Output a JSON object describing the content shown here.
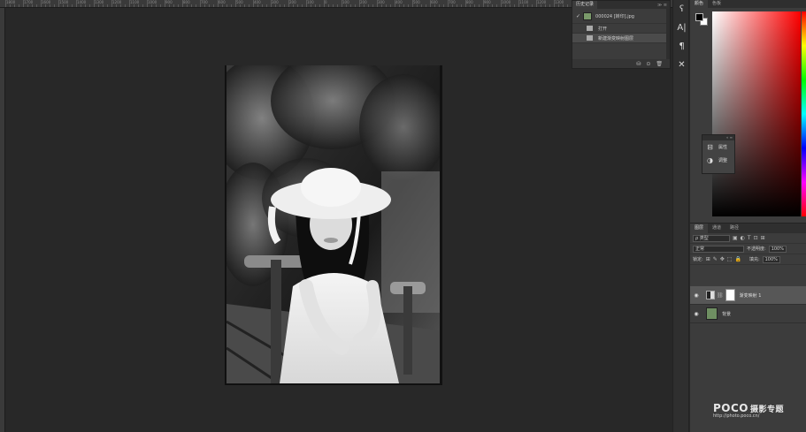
{
  "ruler": {
    "labels": [
      "1800",
      "1700",
      "1600",
      "1500",
      "1400",
      "1300",
      "1200",
      "1100",
      "1000",
      "900",
      "800",
      "700",
      "600",
      "500",
      "400",
      "300",
      "200",
      "100",
      "0",
      "100",
      "200",
      "300",
      "400",
      "500",
      "600",
      "700",
      "800",
      "900",
      "1000",
      "1100",
      "1200",
      "1300",
      "1400",
      "1500",
      "1600",
      "1700",
      "1800",
      "1900",
      "2000"
    ]
  },
  "history": {
    "tab_label": "历史记录",
    "menu_glyph": "≫ ≡",
    "snapshot_label": "000024 [转印].jpg",
    "steps": [
      "打开",
      "新建渐变映射图层"
    ],
    "footer_icons": [
      "⛁",
      "⊙",
      "🗑"
    ]
  },
  "tools": [
    "ʕ",
    "A|",
    "¶",
    "✕"
  ],
  "color_panel": {
    "tabs": [
      "颜色",
      "色板"
    ],
    "fg_color": "#000000",
    "bg_color": "#ffffff"
  },
  "mini_panel": {
    "items": [
      {
        "glyph": "⊟",
        "label": "属性"
      },
      {
        "glyph": "◑",
        "label": "调整"
      }
    ]
  },
  "layers": {
    "tabs": [
      "图层",
      "通道",
      "路径"
    ],
    "filter_kind": "ρ 类型",
    "blend_mode": "正常",
    "opacity_label": "不透明度:",
    "opacity_value": "100%",
    "lock_label": "锁定:",
    "fill_label": "填充:",
    "fill_value": "100%",
    "list": [
      {
        "name": "渐变映射 1",
        "type": "adjustment",
        "active": true
      },
      {
        "name": "背景",
        "type": "background",
        "active": false
      }
    ]
  },
  "watermark": {
    "brand": "POCO",
    "brand_cn": "摄影专题",
    "url": "http://photo.poco.cn/"
  }
}
